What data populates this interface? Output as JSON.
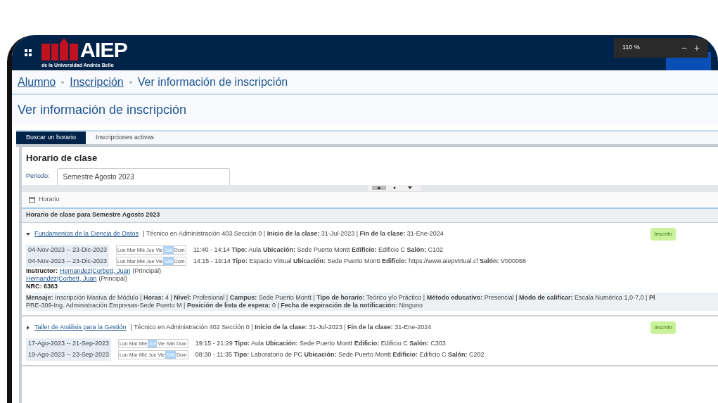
{
  "header": {
    "logo_text": "AIEP",
    "logo_subtitle": "de la Universidad Andrés Bello"
  },
  "zoom_popup": {
    "level": "110 %",
    "buttons": [
      "−",
      "+"
    ]
  },
  "breadcrumb": [
    {
      "label": "Alumno",
      "kind": "link"
    },
    {
      "label": "Inscripción",
      "kind": "link"
    },
    {
      "label": "Ver información de inscripción",
      "kind": "current"
    }
  ],
  "page_title": "Ver información de inscripción",
  "tabs": [
    {
      "label": "Buscar un horario",
      "selected": true
    },
    {
      "label": "Inscripciones activas",
      "selected": false
    }
  ],
  "schedule": {
    "title": "Horario de clase",
    "period": {
      "label": "Periodo:",
      "value": "Semestre Agosto 2023"
    }
  },
  "view_button": "Horario",
  "section_title": "Horario de clase para Semestre Agosto 2023",
  "courses": [
    {
      "expanded": true,
      "title": "Fundamentos de la Ciencia de Datos",
      "details": "| Técnico en Administración 403 Sección 0 | **Inicio de la clase:** 31-Jul-2023 | **Fin de la clase:** 31-Ene-2024",
      "status": "Inscrito",
      "meetings": [
        {
          "dates": "04-Nov-2023 -- 23-Dic-2023",
          "days": [
            {
              "label": "Lun",
              "selected": false
            },
            {
              "label": "Mar",
              "selected": false
            },
            {
              "label": "Mié",
              "selected": false
            },
            {
              "label": "Jue",
              "selected": false
            },
            {
              "label": "Vie",
              "selected": false
            },
            {
              "label": "Sáb",
              "selected": true
            },
            {
              "label": "Dom",
              "selected": false
            }
          ],
          "info": "11:40 - 14:14 **Tipo:** Aula **Ubicación:** Sede Puerto Montt **Edificio:** Edificio C **Salón:** C102"
        },
        {
          "dates": "04-Nov-2023 -- 23-Dic-2023",
          "days": [
            {
              "label": "Lun",
              "selected": false
            },
            {
              "label": "Mar",
              "selected": false
            },
            {
              "label": "Mié",
              "selected": false
            },
            {
              "label": "Jue",
              "selected": false
            },
            {
              "label": "Vie",
              "selected": false
            },
            {
              "label": "Sáb",
              "selected": true
            },
            {
              "label": "Dom",
              "selected": false
            }
          ],
          "info": "14:15 - 19:14 **Tipo:** Espacio Virtual **Ubicación:** Sede Puerto Montt **Edificio:** https://www.aiepvirtual.cl **Salón:** V000068"
        }
      ],
      "instructor_label": "Instructor:",
      "instructors": [
        {
          "name": "Hernandez|Corbett, Juan",
          "role": "(Principal)"
        },
        {
          "name": "Hernandez|Corbett, Juan",
          "role": "(Principal)"
        }
      ],
      "nrc": "NRC: 6363",
      "message_lines": [
        "**Mensaje:** Inscripción Masiva de Módulo | **Horas:** 4 | **Nivel:** Profesional | **Campus:** Sede Puerto Montt | **Tipo de horario:** Teórico y/o Práctico | **Método educativo:** Presencial | **Modo de calificar:** Escala Numérica 1,0-7,0 | **Pl**",
        "PRE-309-Ing. Administración Empresas-Sede Puerto M | **Posición de lista de espera:** 0 | **Fecha de expiración de la notificación:** Ninguno"
      ]
    },
    {
      "expanded": false,
      "title": "Taller de Análisis para la Gestión",
      "details": "| Técnico en Administración 402 Sección 0 | **Inicio de la clase:** 31-Jul-2023 | **Fin de la clase:** 31-Ene-2024",
      "status": "Inscrito",
      "meetings": [
        {
          "dates": "17-Ago-2023 -- 21-Sep-2023",
          "days": [
            {
              "label": "Lun",
              "selected": false
            },
            {
              "label": "Mar",
              "selected": false
            },
            {
              "label": "Mié",
              "selected": false
            },
            {
              "label": "Jue",
              "selected": true
            },
            {
              "label": "Vie",
              "selected": false
            },
            {
              "label": "Sáb",
              "selected": false
            },
            {
              "label": "Dom",
              "selected": false
            }
          ],
          "info": "19:15 - 21:29 **Tipo:** Aula **Ubicación:** Sede Puerto Montt **Edificio:** Edificio C **Salón:** C303"
        },
        {
          "dates": "19-Ago-2023 -- 23-Sep-2023",
          "days": [
            {
              "label": "Lun",
              "selected": false
            },
            {
              "label": "Mar",
              "selected": false
            },
            {
              "label": "Mié",
              "selected": false
            },
            {
              "label": "Jue",
              "selected": false
            },
            {
              "label": "Vie",
              "selected": false
            },
            {
              "label": "Sáb",
              "selected": true
            },
            {
              "label": "Dom",
              "selected": false
            }
          ],
          "info": "08:30 - 11:35 **Tipo:** Laboratorio de PC **Ubicación:** Sede Puerto Montt **Edificio:** Edificio C **Salón:** C202"
        }
      ]
    }
  ]
}
